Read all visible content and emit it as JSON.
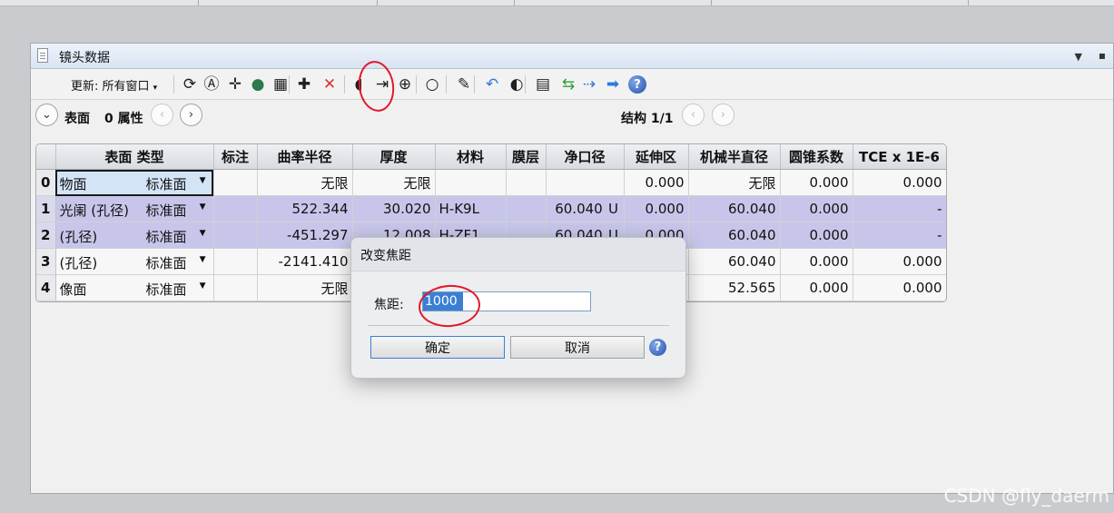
{
  "window": {
    "title": "镜头数据"
  },
  "toolbar": {
    "update_label": "更新: 所有窗口",
    "update_arrow": "▾",
    "icons": [
      {
        "name": "refresh-icon",
        "glyph": "⟳"
      },
      {
        "name": "auto-update-icon",
        "glyph": "Ⓐ"
      },
      {
        "name": "crosshair-icon",
        "glyph": "✛"
      },
      {
        "name": "globe-icon",
        "glyph": "●"
      },
      {
        "name": "glass-icon",
        "glyph": "▦"
      },
      {
        "name": "insert-surface-icon",
        "glyph": "✚"
      },
      {
        "name": "delete-surface-icon",
        "glyph": "✕"
      },
      {
        "name": "lens-icon",
        "glyph": "◖"
      },
      {
        "name": "change-focal-length-icon",
        "glyph": "⇥"
      },
      {
        "name": "aperture-icon",
        "glyph": "⊕"
      },
      {
        "name": "circle-icon",
        "glyph": "○"
      },
      {
        "name": "edit-icon",
        "glyph": "✎"
      },
      {
        "name": "undo-icon",
        "glyph": "↶"
      },
      {
        "name": "toggle-icon",
        "glyph": "◐"
      },
      {
        "name": "document-icon",
        "glyph": "▤"
      },
      {
        "name": "swap-icon",
        "glyph": "⇆"
      },
      {
        "name": "collapse-icon",
        "glyph": "⇢"
      },
      {
        "name": "arrow-right-icon",
        "glyph": "➡"
      },
      {
        "name": "help-icon",
        "glyph": "?"
      }
    ]
  },
  "subbar": {
    "surface_label": "表面",
    "property_label": "0 属性",
    "structure_label": "结构 1/1"
  },
  "table": {
    "columns": [
      "",
      "表面 类型",
      "标注",
      "曲率半径",
      "厚度",
      "材料",
      "膜层",
      "净口径",
      "延伸区",
      "机械半直径",
      "圆锥系数",
      "TCE x 1E-6"
    ],
    "rows": [
      {
        "no": "0",
        "name": "物面",
        "type": "标准面",
        "comment": "",
        "radius": "无限",
        "thickness": "无限",
        "material": "",
        "coating": "",
        "clear": "",
        "clear_flag": "",
        "chip": "0.000",
        "mech": "无限",
        "conic": "0.000",
        "tce": "0.000"
      },
      {
        "no": "1",
        "name": "光阑 (孔径)",
        "type": "标准面",
        "comment": "",
        "radius": "522.344",
        "thickness": "30.020",
        "material": "H-K9L",
        "coating": "",
        "clear": "60.040",
        "clear_flag": "U",
        "chip": "0.000",
        "mech": "60.040",
        "conic": "0.000",
        "tce": "-"
      },
      {
        "no": "2",
        "name": "(孔径)",
        "type": "标准面",
        "comment": "",
        "radius": "-451.297",
        "thickness": "12.008",
        "material": "H-ZF1",
        "coating": "",
        "clear": "60.040",
        "clear_flag": "U",
        "chip": "0.000",
        "mech": "60.040",
        "conic": "0.000",
        "tce": "-"
      },
      {
        "no": "3",
        "name": "(孔径)",
        "type": "标准面",
        "comment": "",
        "radius": "-2141.410",
        "thickness": "",
        "material": "",
        "coating": "",
        "clear": "",
        "clear_flag": "",
        "chip": "",
        "mech": "60.040",
        "conic": "0.000",
        "tce": "0.000"
      },
      {
        "no": "4",
        "name": "像面",
        "type": "标准面",
        "comment": "",
        "radius": "无限",
        "thickness": "",
        "material": "",
        "coating": "",
        "clear": "",
        "clear_flag": "",
        "chip": "",
        "mech": "52.565",
        "conic": "0.000",
        "tce": "0.000"
      }
    ]
  },
  "dialog": {
    "title": "改变焦距",
    "field_label": "焦距:",
    "field_value": "1000",
    "ok_label": "确定",
    "cancel_label": "取消",
    "help_glyph": "?"
  },
  "watermark": "CSDN @fly_daerm",
  "colors": {
    "selected_row": "#c7c6ea",
    "annotation": "#e2182b",
    "input_selection": "#3a7fd4"
  }
}
